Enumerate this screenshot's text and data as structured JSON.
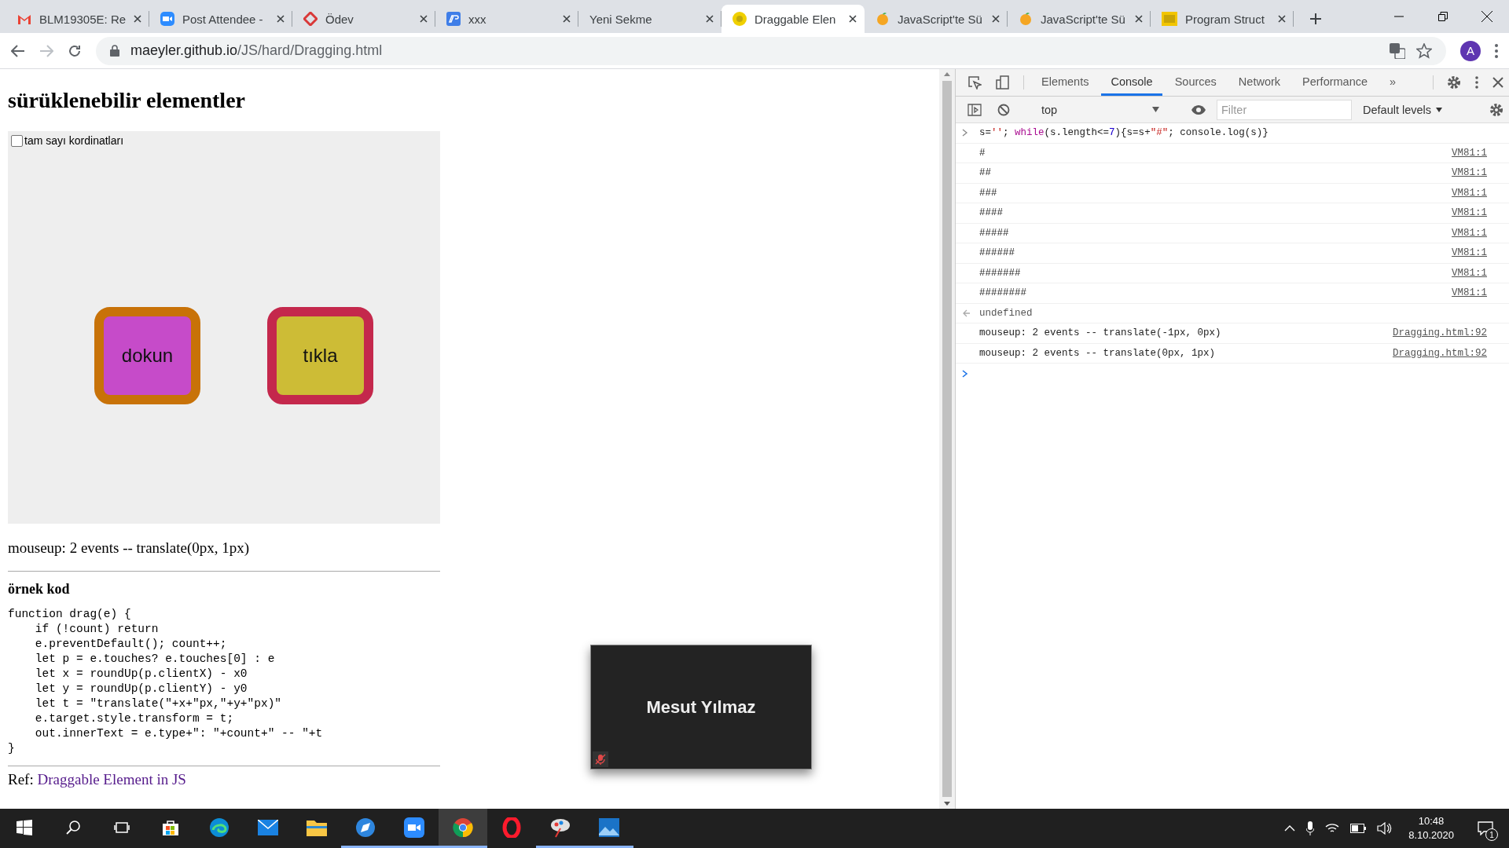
{
  "browser": {
    "tabs": [
      {
        "title": "BLM19305E: Re",
        "selected": false
      },
      {
        "title": "Post Attendee -",
        "selected": false
      },
      {
        "title": "Ödev",
        "selected": false
      },
      {
        "title": "xxx",
        "selected": false
      },
      {
        "title": "Yeni Sekme",
        "selected": false
      },
      {
        "title": "Draggable Elen",
        "selected": true
      },
      {
        "title": "JavaScript'te Sü",
        "selected": false
      },
      {
        "title": "JavaScript'te Sü",
        "selected": false
      },
      {
        "title": "Program Struct",
        "selected": false
      }
    ],
    "address": {
      "host": "maeyler.github.io",
      "path": "/JS/hard/Dragging.html"
    },
    "profile": "A"
  },
  "page": {
    "heading": "sürüklenebilir elementler",
    "option": {
      "label": "tam sayı kordinatları",
      "checked": false
    },
    "draggables": [
      {
        "label": "dokun",
        "color": "#c64bc9",
        "frame": {
          "color": "#c87208"
        }
      },
      {
        "label": "tıkla",
        "color": "#cdbc36",
        "frame": {
          "color": "#c4284c"
        }
      }
    ],
    "output": "mouseup: 2 events -- translate(0px, 1px)",
    "code_title": "örnek kod",
    "code": "function drag(e) {\n    if (!count) return\n    e.preventDefault(); count++;\n    let p = e.touches? e.touches[0] : e\n    let x = roundUp(p.clientX) - x0\n    let y = roundUp(p.clientY) - y0\n    let t = \"translate(\"+x+\"px,\"+y+\"px)\"\n    e.target.style.transform = t;\n    out.innerText = e.type+\": \"+count+\" -- \"+t\n}",
    "reference": {
      "prefix": "Ref: ",
      "link": "Draggable Element in JS"
    }
  },
  "video": {
    "name": "Mesut Yılmaz",
    "muted": true
  },
  "devtools": {
    "tabs": [
      {
        "label": "Elements",
        "selected": false
      },
      {
        "label": "Console",
        "selected": true
      },
      {
        "label": "Sources",
        "selected": false
      },
      {
        "label": "Network",
        "selected": false
      },
      {
        "label": "Performance",
        "selected": false
      }
    ],
    "more": "»",
    "context": "top",
    "filter": {
      "placeholder": "Filter"
    },
    "levels": "Default levels",
    "console": [
      {
        "kind": "input",
        "tokens": [
          {
            "kind": "plain",
            "text": "s="
          },
          {
            "kind": "string",
            "text": "''"
          },
          {
            "kind": "plain",
            "text": "; "
          },
          {
            "kind": "keyword",
            "text": "while"
          },
          {
            "kind": "plain",
            "text": "(s.length"
          },
          {
            "kind": "operator",
            "text": "<="
          },
          {
            "kind": "number",
            "text": "7"
          },
          {
            "kind": "plain",
            "text": "){s=s"
          },
          {
            "kind": "operator",
            "text": "+"
          },
          {
            "kind": "string",
            "text": "\"#\""
          },
          {
            "kind": "plain",
            "text": "; console.log(s)}"
          }
        ]
      },
      {
        "kind": "log",
        "text": "#",
        "source": "VM81:1"
      },
      {
        "kind": "log",
        "text": "##",
        "source": "VM81:1"
      },
      {
        "kind": "log",
        "text": "###",
        "source": "VM81:1"
      },
      {
        "kind": "log",
        "text": "####",
        "source": "VM81:1"
      },
      {
        "kind": "log",
        "text": "#####",
        "source": "VM81:1"
      },
      {
        "kind": "log",
        "text": "######",
        "source": "VM81:1"
      },
      {
        "kind": "log",
        "text": "#######",
        "source": "VM81:1"
      },
      {
        "kind": "log",
        "text": "########",
        "source": "VM81:1"
      },
      {
        "kind": "result",
        "text": "undefined"
      },
      {
        "kind": "log",
        "text": "mouseup: 2 events -- translate(-1px, 0px)",
        "source": "Dragging.html:92"
      },
      {
        "kind": "log",
        "text": "mouseup: 2 events -- translate(0px, 1px)",
        "source": "Dragging.html:92"
      },
      {
        "kind": "prompt"
      }
    ]
  },
  "taskbar": {
    "apps": [
      {
        "running": false,
        "selected": false
      },
      {
        "running": false,
        "selected": false
      },
      {
        "running": false,
        "selected": false
      },
      {
        "running": false,
        "selected": false
      },
      {
        "running": true,
        "selected": false
      },
      {
        "running": true,
        "selected": false
      },
      {
        "running": true,
        "selected": true
      },
      {
        "running": false,
        "selected": false
      },
      {
        "running": true,
        "selected": false
      },
      {
        "running": true,
        "selected": false
      }
    ],
    "time": "10:48",
    "date": "8.10.2020",
    "notifications": "1"
  }
}
